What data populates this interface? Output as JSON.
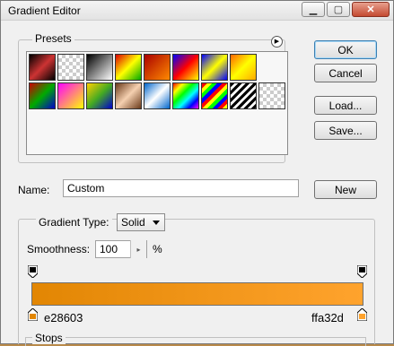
{
  "window": {
    "title": "Gradient Editor",
    "controls": {
      "minimize_icon": "minimize-icon",
      "maximize_icon": "maximize-icon",
      "close_icon": "close-icon"
    }
  },
  "presets": {
    "label": "Presets",
    "menu_icon": "flyout-arrow-icon"
  },
  "buttons": {
    "ok": "OK",
    "cancel": "Cancel",
    "load": "Load...",
    "save": "Save...",
    "new": "New"
  },
  "name": {
    "label": "Name:",
    "value": "Custom"
  },
  "gradient_type": {
    "label": "Gradient Type:",
    "value": "Solid"
  },
  "smoothness": {
    "label": "Smoothness:",
    "value": "100",
    "unit": "%"
  },
  "gradient": {
    "start_color": "e28603",
    "end_color": "ffa32d",
    "start_hex": "#e28603",
    "end_hex": "#ffa32d"
  },
  "stops": {
    "label": "Stops"
  },
  "colors": {
    "accent": "#3c7fb1",
    "close": "#c44a31"
  }
}
